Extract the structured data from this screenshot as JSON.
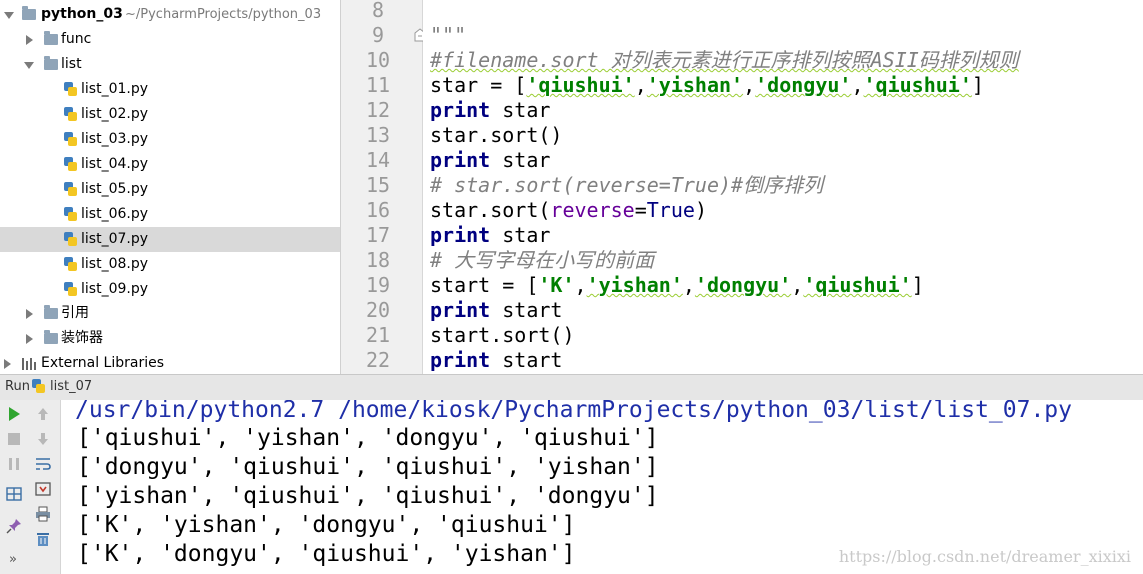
{
  "project_tree": {
    "root": {
      "name": "python_03",
      "path": "~/PycharmProjects/python_03"
    },
    "items": [
      {
        "label": "func"
      },
      {
        "label": "list"
      },
      {
        "label": "list_01.py"
      },
      {
        "label": "list_02.py"
      },
      {
        "label": "list_03.py"
      },
      {
        "label": "list_04.py"
      },
      {
        "label": "list_05.py"
      },
      {
        "label": "list_06.py"
      },
      {
        "label": "list_07.py",
        "selected": true
      },
      {
        "label": "list_08.py"
      },
      {
        "label": "list_09.py"
      },
      {
        "label": "引用"
      },
      {
        "label": "装饰器"
      },
      {
        "label": "External Libraries"
      }
    ]
  },
  "editor": {
    "line_numbers": [
      "8",
      "9",
      "10",
      "11",
      "12",
      "13",
      "14",
      "15",
      "16",
      "17",
      "18",
      "19",
      "20",
      "21",
      "22"
    ],
    "lines": {
      "l9_docstring": "\"\"\"",
      "l10_comment": "#filename.sort 对列表元素进行正序排列按照ASII码排列规则",
      "l11_var": "star",
      "l11_op": " = [",
      "l11_s1": "'qiushui'",
      "l11_s2": "'yishan'",
      "l11_s3": "'dongyu'",
      "l11_s4": "'qiushui'",
      "l11_close": "]",
      "print_kw": "print",
      "l12_arg": " star",
      "l13_code": "star.sort()",
      "l14_arg": " star",
      "l15_comment": "# star.sort(reverse=True)#倒序排列",
      "l16_pre": "star.sort(",
      "l16_kwarg": "reverse",
      "l16_eq": "=",
      "l16_true": "True",
      "l16_close": ")",
      "l17_arg": " star",
      "l18_comment": "# 大写字母在小写的前面",
      "l19_var": "start",
      "l19_op": " = [",
      "l19_s1": "'K'",
      "l19_s2": "'yishan'",
      "l19_s3": "'dongyu'",
      "l19_s4": "'qiushui'",
      "l19_close": "]",
      "l20_arg": " start",
      "l21_code": "start.sort()",
      "l22_arg": " start",
      "comma": ","
    }
  },
  "run_panel": {
    "title": "Run",
    "config": "list_07",
    "output": [
      "/usr/bin/python2.7 /home/kiosk/PycharmProjects/python_03/list/list_07.py",
      "['qiushui', 'yishan', 'dongyu', 'qiushui']",
      "['dongyu', 'qiushui', 'qiushui', 'yishan']",
      "['yishan', 'qiushui', 'qiushui', 'dongyu']",
      "['K', 'yishan', 'dongyu', 'qiushui']",
      "['K', 'dongyu', 'qiushui', 'yishan']"
    ],
    "more": "»"
  },
  "watermark": "https://blog.csdn.net/dreamer_xixixi",
  "colors": {
    "keyword": "#000080",
    "string": "#008000",
    "comment": "#808080",
    "selection": "#d9d9d9",
    "run_green": "#2fa52f"
  }
}
